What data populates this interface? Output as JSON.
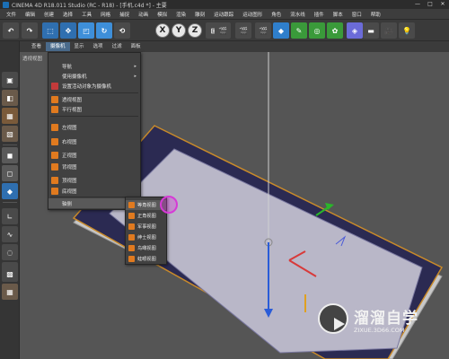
{
  "window": {
    "title": "CINEMA 4D R18.011 Studio (RC - R18) - [手机.c4d *] - 主要",
    "controls": [
      "—",
      "□",
      "✕"
    ]
  },
  "menubar": {
    "items": [
      "文件",
      "编辑",
      "创建",
      "选择",
      "工具",
      "网格",
      "捕捉",
      "动画",
      "模拟",
      "渲染",
      "雕刻",
      "运动跟踪",
      "运动图形",
      "角色",
      "流水线",
      "插件",
      "脚本",
      "窗口",
      "帮助"
    ]
  },
  "toolbar": {
    "undo_icon": "undo-icon",
    "xyz": [
      "X",
      "Y",
      "Z"
    ],
    "accent": "#e07a1f"
  },
  "viewport_menu": {
    "items": [
      "查看",
      "摄像机",
      "显示",
      "选项",
      "过滤",
      "面板"
    ],
    "active_index": 1
  },
  "viewport": {
    "label": "透视视图",
    "background": "#555555"
  },
  "camera_menu": {
    "items": [
      {
        "label": "导航",
        "arrow": "▸",
        "icon": false
      },
      {
        "label": "使用摄像机",
        "arrow": "▸",
        "icon": false
      },
      {
        "label": "设置活动对象为摄像机",
        "arrow": "",
        "icon": true
      },
      {
        "label": "透视视图",
        "arrow": "",
        "icon": true
      },
      {
        "label": "平行视图",
        "arrow": "",
        "icon": true
      },
      {
        "label": "左视图",
        "arrow": "",
        "icon": true
      },
      {
        "label": "右视图",
        "arrow": "",
        "icon": true
      },
      {
        "label": "正视图",
        "arrow": "",
        "icon": true
      },
      {
        "label": "背视图",
        "arrow": "",
        "icon": true
      },
      {
        "label": "顶视图",
        "arrow": "",
        "icon": true
      },
      {
        "label": "底视图",
        "arrow": "",
        "icon": true
      },
      {
        "label": "轴侧",
        "arrow": "▸",
        "icon": false
      }
    ]
  },
  "axonometric_submenu": {
    "items": [
      "等角视图",
      "正角视图",
      "军事视图",
      "绅士视图",
      "鸟瞰视图",
      "蛙眼视图"
    ]
  },
  "watermark": {
    "title": "溜溜自学",
    "subtitle": "ZIXUE.3D66.COM"
  }
}
